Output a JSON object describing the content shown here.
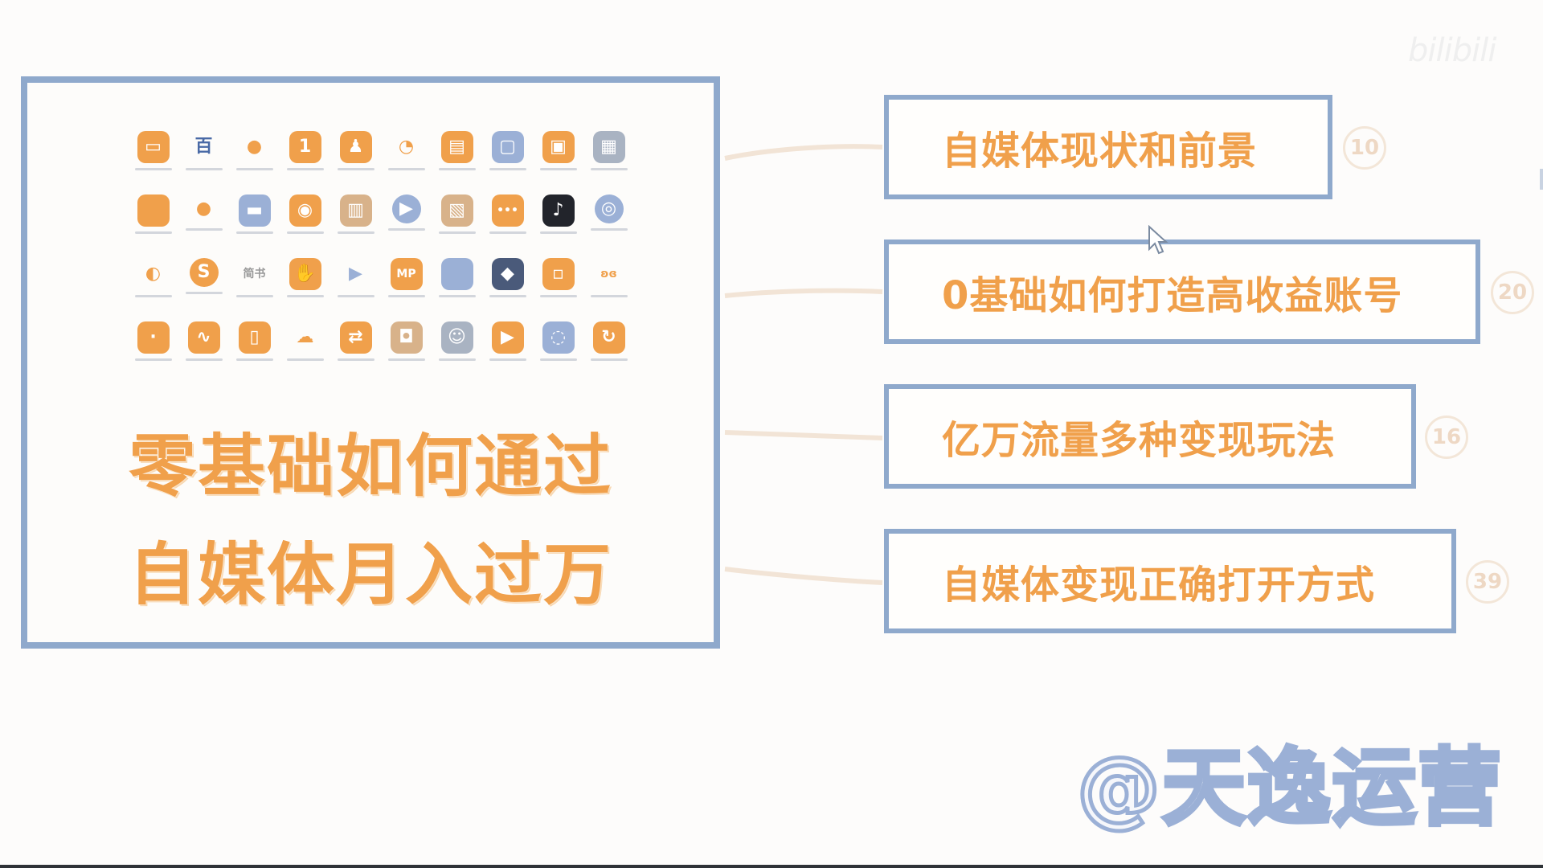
{
  "slide": {
    "headline_line1": "零基础如何通过",
    "headline_line2": "自媒体月入过万"
  },
  "apps": [
    {
      "icon": "ticket-icon",
      "glyph": "▭",
      "color": "#f0a04b"
    },
    {
      "icon": "newspaper-icon",
      "glyph": "百",
      "color": "#4a6aa6",
      "plain": true
    },
    {
      "icon": "flame-icon",
      "glyph": "●",
      "color": "#f0a04b",
      "plain": true
    },
    {
      "icon": "calendar-icon",
      "glyph": "1",
      "color": "#f0a04b"
    },
    {
      "icon": "penguin-icon",
      "glyph": "♟",
      "color": "#f0a04b"
    },
    {
      "icon": "swirl-icon",
      "glyph": "◔",
      "color": "#f0a04b",
      "plain": true
    },
    {
      "icon": "media-icon",
      "glyph": "▤",
      "color": "#f0a04b"
    },
    {
      "icon": "square-outline-icon",
      "glyph": "▢",
      "color": "#9bb0d6"
    },
    {
      "icon": "clock-icon",
      "glyph": "▣",
      "color": "#f0a04b"
    },
    {
      "icon": "photo-icon",
      "glyph": "▦",
      "color": "#a9b3c2"
    },
    {
      "icon": "orange-square-icon",
      "glyph": "",
      "color": "#f0a04b"
    },
    {
      "icon": "dot-icon",
      "glyph": "●",
      "color": "#f0a04b",
      "plain": true,
      "round": true
    },
    {
      "icon": "dashboard-icon",
      "glyph": "▬",
      "color": "#9bb0d6"
    },
    {
      "icon": "camera-icon",
      "glyph": "◉",
      "color": "#f0a04b"
    },
    {
      "icon": "folder-icon",
      "glyph": "▥",
      "color": "#d8b28a"
    },
    {
      "icon": "play-icon",
      "glyph": "▶",
      "color": "#9bb0d6",
      "round": true
    },
    {
      "icon": "gift-icon",
      "glyph": "▧",
      "color": "#d8b28a"
    },
    {
      "icon": "chat-dots-icon",
      "glyph": "•••",
      "color": "#f0a04b"
    },
    {
      "icon": "tiktok-icon",
      "glyph": "♪",
      "color": "#22242b"
    },
    {
      "icon": "wechat-icon",
      "glyph": "◎",
      "color": "#9bb0d6",
      "round": true
    },
    {
      "icon": "weibo-icon",
      "glyph": "◐",
      "color": "#f0a04b",
      "plain": true
    },
    {
      "icon": "sync-icon",
      "glyph": "S",
      "color": "#f0a04b",
      "round": true
    },
    {
      "icon": "text-logo-icon",
      "glyph": "简书",
      "color": "#999999",
      "plain": true
    },
    {
      "icon": "hand-icon",
      "glyph": "✋",
      "color": "#f0a04b"
    },
    {
      "icon": "triangle-play-icon",
      "glyph": "▶",
      "color": "#9bb0d6",
      "plain": true
    },
    {
      "icon": "mp-icon",
      "glyph": "MP",
      "color": "#f0a04b"
    },
    {
      "icon": "blue-square-icon",
      "glyph": "",
      "color": "#9bb0d6"
    },
    {
      "icon": "game-icon",
      "glyph": "◆",
      "color": "#4a5a7a"
    },
    {
      "icon": "note-icon",
      "glyph": "▫",
      "color": "#f0a04b"
    },
    {
      "icon": "butterfly-icon",
      "glyph": "ʚɞ",
      "color": "#f0a04b",
      "plain": true
    },
    {
      "icon": "square-dot-icon",
      "glyph": "·",
      "color": "#f0a04b"
    },
    {
      "icon": "waveform-icon",
      "glyph": "∿",
      "color": "#f0a04b"
    },
    {
      "icon": "book-icon",
      "glyph": "▯",
      "color": "#f0a04b"
    },
    {
      "icon": "cloud-icon",
      "glyph": "☁",
      "color": "#f0a04b",
      "plain": true
    },
    {
      "icon": "swap-icon",
      "glyph": "⇄",
      "color": "#f0a04b"
    },
    {
      "icon": "bag-icon",
      "glyph": "◘",
      "color": "#d8b28a"
    },
    {
      "icon": "character-icon",
      "glyph": "☺",
      "color": "#a9b3c2"
    },
    {
      "icon": "video-play-icon",
      "glyph": "▶",
      "color": "#f0a04b"
    },
    {
      "icon": "mic-icon",
      "glyph": "◌",
      "color": "#9bb0d6"
    },
    {
      "icon": "refresh-icon",
      "glyph": "↻",
      "color": "#f0a04b"
    }
  ],
  "topics": [
    {
      "title": "自媒体现状和前景",
      "count": "10"
    },
    {
      "title": "0基础如何打造高收益账号",
      "count": "20"
    },
    {
      "title": "亿万流量多种变现玩法",
      "count": "16"
    },
    {
      "title": "自媒体变现正确打开方式",
      "count": "39"
    }
  ],
  "watermark": {
    "site_logo": "bilibili",
    "author": "@天逸运营"
  },
  "colors": {
    "accent": "#f0a04b",
    "border": "#8fa9cc",
    "background": "#fdfcfb"
  }
}
